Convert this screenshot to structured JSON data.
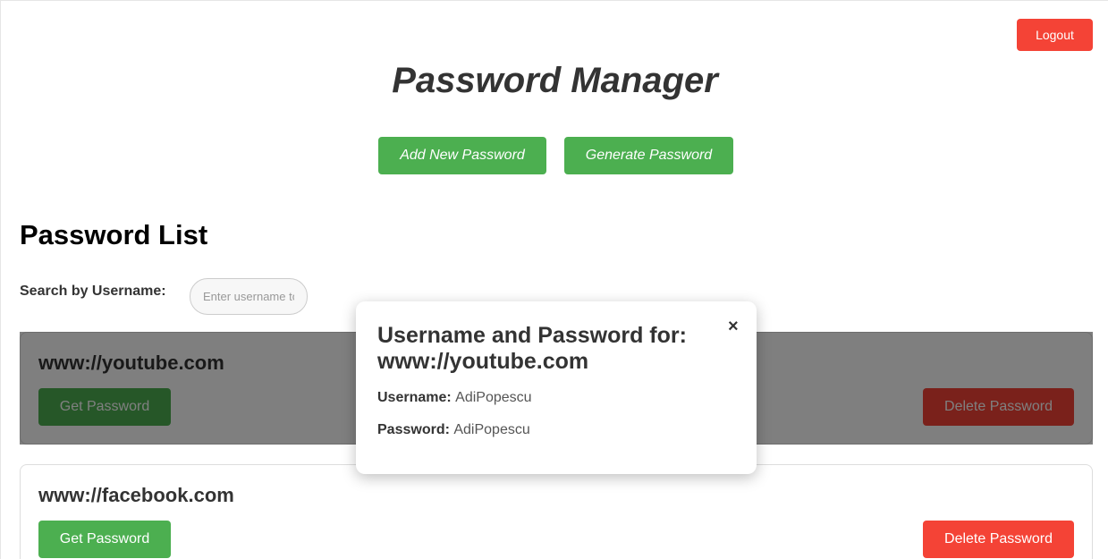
{
  "header": {
    "logout_label": "Logout",
    "title": "Password Manager",
    "add_label": "Add New Password",
    "generate_label": "Generate Password"
  },
  "list": {
    "title": "Password List",
    "search_label": "Search by Username:",
    "search_placeholder": "Enter username to search",
    "search_value": "",
    "entries": [
      {
        "site": "www://youtube.com",
        "get_label": "Get Password",
        "delete_label": "Delete Password"
      },
      {
        "site": "www://facebook.com",
        "get_label": "Get Password",
        "delete_label": "Delete Password"
      }
    ]
  },
  "modal": {
    "title": "Username and Password for: www://youtube.com",
    "close_glyph": "×",
    "username_label": "Username:",
    "username_value": "AdiPopescu",
    "password_label": "Password:",
    "password_value": "AdiPopescu"
  },
  "colors": {
    "green": "#4caf50",
    "red": "#f44336",
    "overlay": "rgba(0,0,0,0.5)"
  }
}
